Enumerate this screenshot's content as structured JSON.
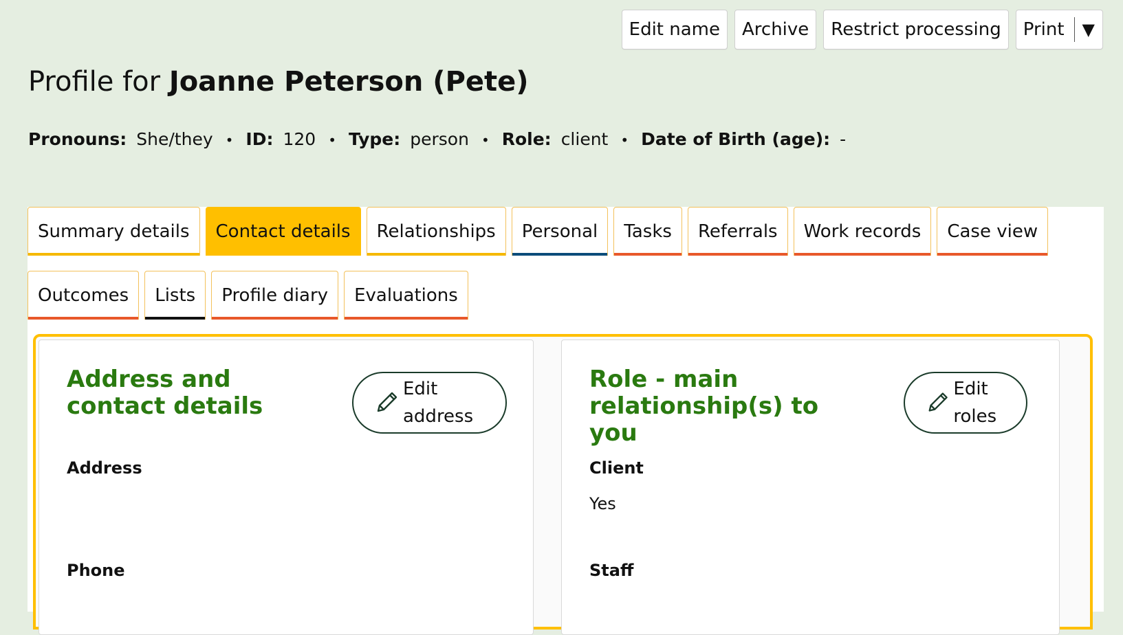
{
  "header_actions": {
    "edit_name": "Edit name",
    "archive": "Archive",
    "restrict_processing": "Restrict processing",
    "print": "Print",
    "print_caret": "▼"
  },
  "title": {
    "prefix": "Profile for",
    "name": "Joanne Peterson (Pete)"
  },
  "meta": {
    "pronouns_label": "Pronouns:",
    "pronouns": "She/they",
    "id_label": "ID:",
    "id": "120",
    "type_label": "Type:",
    "type": "person",
    "role_label": "Role:",
    "role": "client",
    "dob_label": "Date of Birth (age):",
    "dob": "-",
    "separator": "•"
  },
  "tabs": {
    "row1": [
      {
        "label": "Summary details",
        "underline": "#f5b800"
      },
      {
        "label": "Contact details",
        "active": true
      },
      {
        "label": "Relationships",
        "underline": "#f5b800"
      },
      {
        "label": "Personal",
        "underline": "#0b4c7a"
      },
      {
        "label": "Tasks",
        "underline": "#e8582a"
      },
      {
        "label": "Referrals",
        "underline": "#e8582a"
      },
      {
        "label": "Work records",
        "underline": "#e8582a"
      },
      {
        "label": "Case view",
        "underline": "#e8582a"
      }
    ],
    "row2": [
      {
        "label": "Outcomes",
        "underline": "#e8582a"
      },
      {
        "label": "Lists",
        "underline": "#111111"
      },
      {
        "label": "Profile diary",
        "underline": "#e8582a"
      },
      {
        "label": "Evaluations",
        "underline": "#e8582a"
      }
    ]
  },
  "cards": {
    "address": {
      "title": "Address and contact details",
      "edit_label_1": "Edit",
      "edit_label_2": "address",
      "address_label": "Address",
      "phone_label": "Phone"
    },
    "roles": {
      "title": "Role - main relationship(s) to you",
      "edit_label_1": "Edit",
      "edit_label_2": "roles",
      "client_label": "Client",
      "client_value": "Yes",
      "staff_label": "Staff"
    }
  },
  "colors": {
    "accent": "#ffbf00",
    "heading_green": "#2a7a10",
    "background": "#e5eee1",
    "tab_underline_orange": "#e8582a",
    "tab_underline_blue": "#0b4c7a"
  },
  "icons": {
    "edit": "pencil-icon",
    "dropdown": "triangle-down"
  }
}
